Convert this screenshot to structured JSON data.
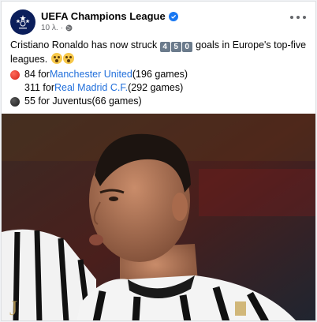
{
  "post": {
    "page_name": "UEFA Champions League",
    "timestamp": "10 λ.",
    "separator": "·",
    "text_before": "Cristiano Ronaldo has now struck ",
    "keycaps": [
      "4",
      "5",
      "0"
    ],
    "text_after": " goals in Europe's top-five leagues.",
    "stats": [
      {
        "count": "84 for ",
        "club": "Manchester United",
        "games": " (196 games)",
        "ball": "red-ball-icon"
      },
      {
        "count": "311 for ",
        "club": "Real Madrid C.F.",
        "games": " (292 games)",
        "ball": "white-ball-icon"
      },
      {
        "count": "55 for Juventus",
        "club": "",
        "games": " (66 games)",
        "ball": "black-ball-icon"
      }
    ]
  },
  "colors": {
    "link": "#216fdb",
    "verified": "#1877f2",
    "meta": "#65676b"
  }
}
